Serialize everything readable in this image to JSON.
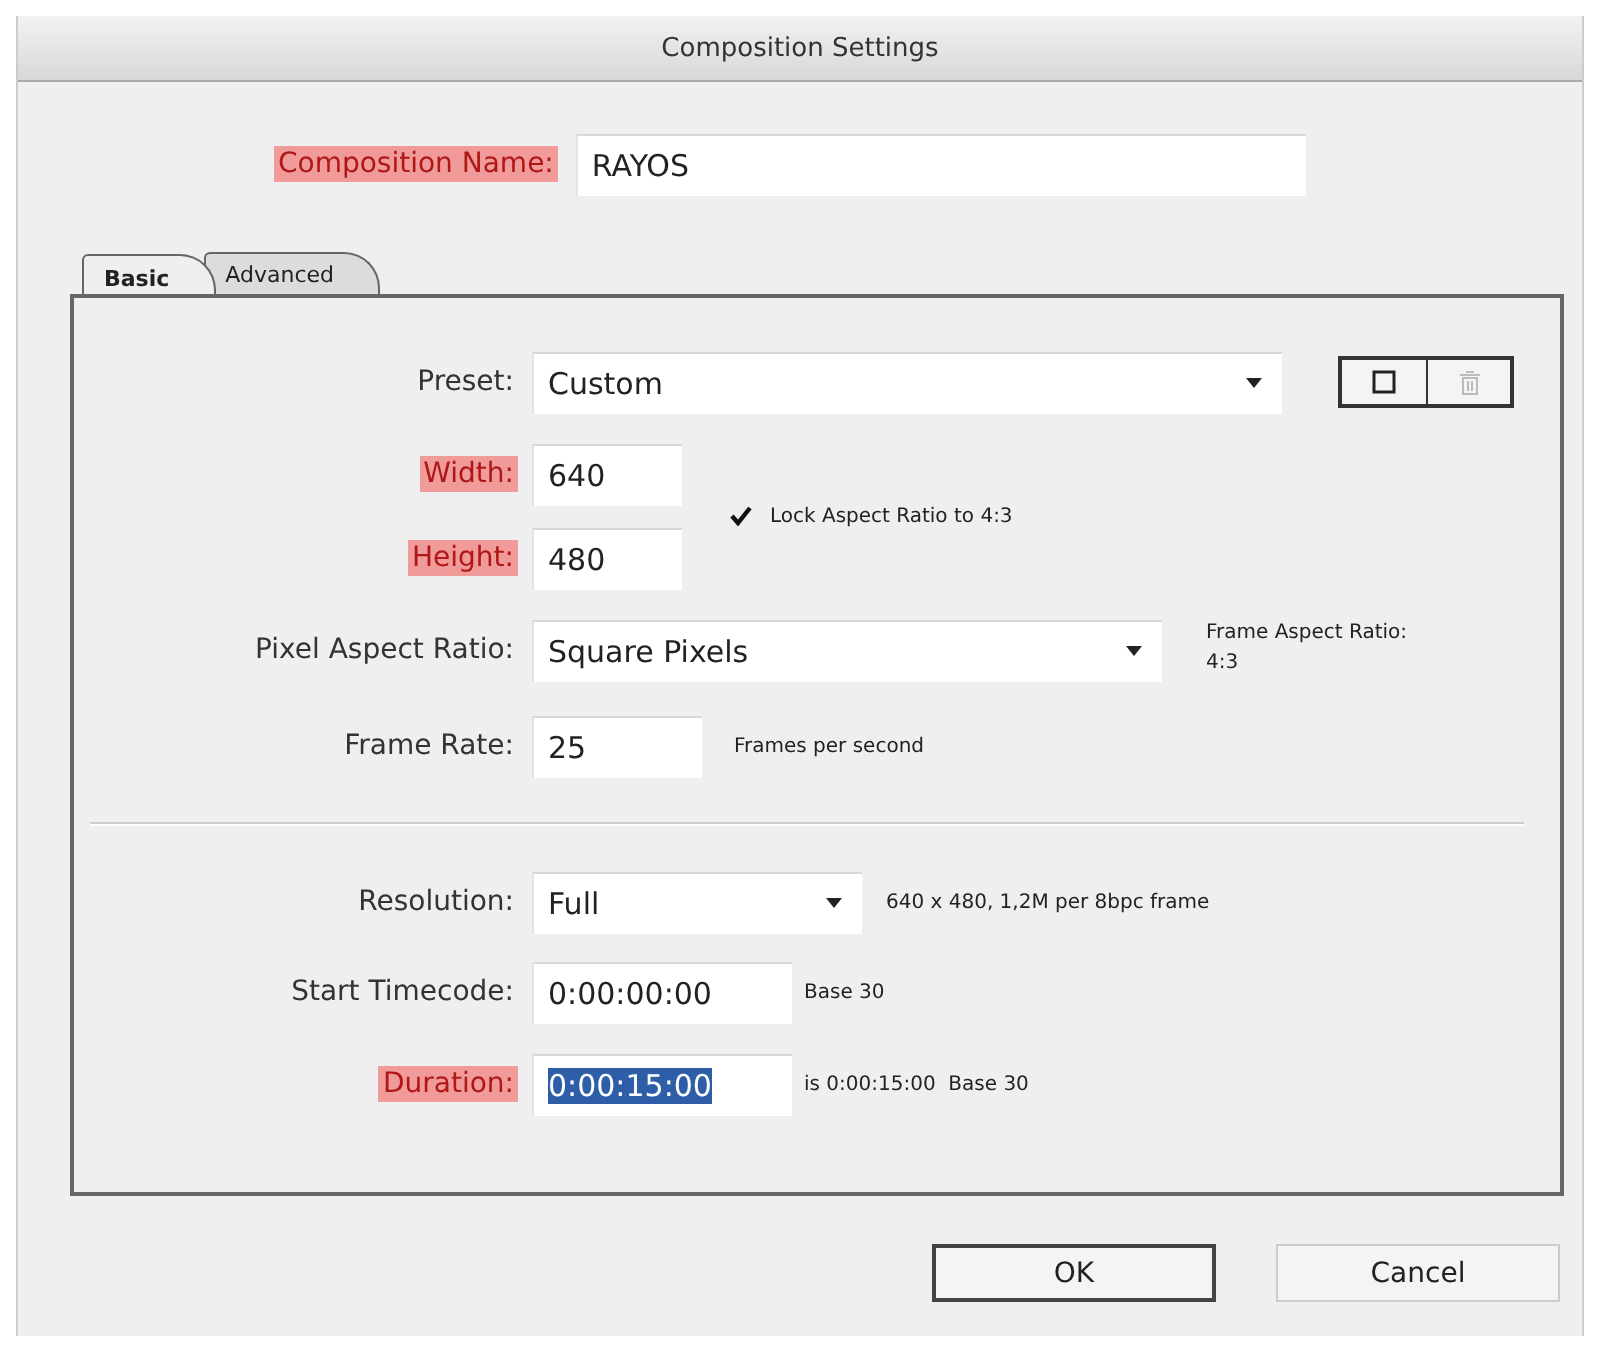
{
  "window": {
    "title": "Composition Settings"
  },
  "composition_name": {
    "label": "Composition Name:",
    "highlighted": true,
    "value": "RAYOS"
  },
  "tabs": [
    {
      "label": "Basic",
      "selected": true
    },
    {
      "label": "Advanced",
      "selected": false
    }
  ],
  "preset": {
    "label": "Preset:",
    "highlighted": false,
    "value": "Custom"
  },
  "width": {
    "label": "Width:",
    "highlighted": true,
    "value": "640"
  },
  "height": {
    "label": "Height:",
    "highlighted": true,
    "value": "480"
  },
  "lock_aspect": {
    "label": "Lock Aspect Ratio to 4:3",
    "checked": true
  },
  "pixel_aspect": {
    "label": "Pixel Aspect Ratio:",
    "highlighted": false,
    "value": "Square Pixels"
  },
  "frame_aspect": {
    "label": "Frame Aspect Ratio:",
    "value": "4:3"
  },
  "frame_rate": {
    "label": "Frame Rate:",
    "highlighted": false,
    "value": "25",
    "note": "Frames per second"
  },
  "resolution": {
    "label": "Resolution:",
    "highlighted": false,
    "value": "Full",
    "note": "640 x 480, 1,2M per 8bpc frame"
  },
  "start_timecode": {
    "label": "Start Timecode:",
    "highlighted": false,
    "value": "0:00:00:00",
    "note": "Base 30"
  },
  "duration": {
    "label": "Duration:",
    "highlighted": true,
    "value": "0:00:15:00",
    "text_selected": true,
    "note": "is 0:00:15:00  Base 30"
  },
  "buttons": [
    {
      "label": "OK",
      "default": true
    },
    {
      "label": "Cancel",
      "default": false
    }
  ]
}
